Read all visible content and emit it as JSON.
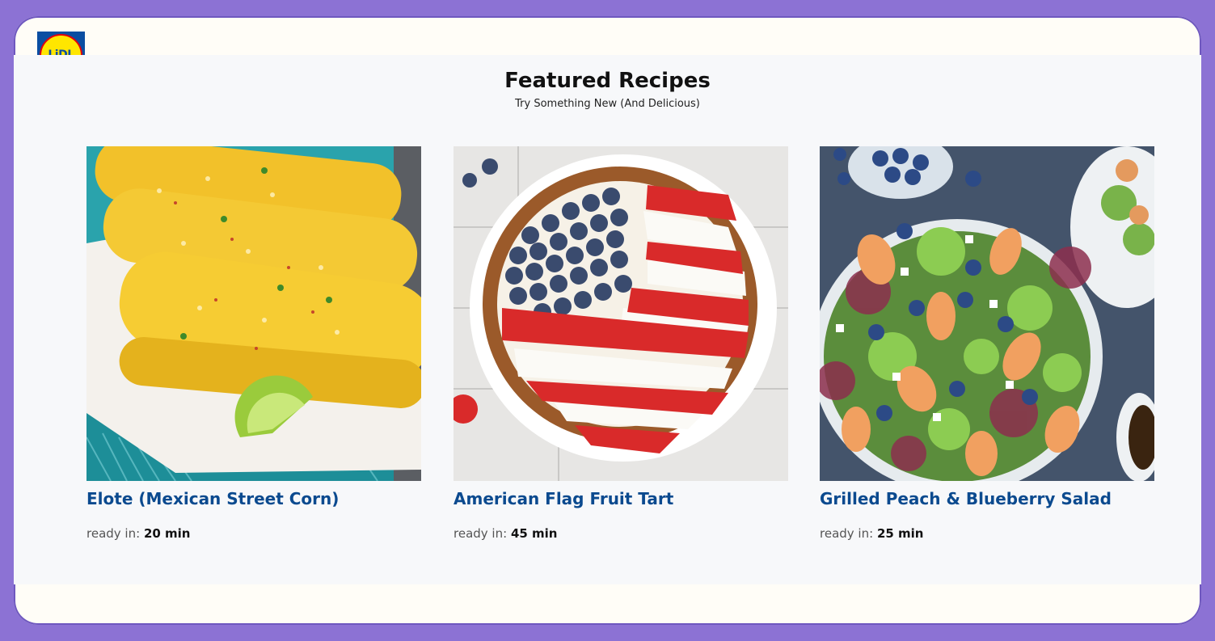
{
  "logo": {
    "text": "LiDL"
  },
  "header": {
    "title": "Featured Recipes",
    "subtitle": "Try Something New (And Delicious)"
  },
  "ready_label": "ready in:",
  "recipes": [
    {
      "title": "Elote (Mexican Street Corn)",
      "time": "20 min",
      "image": "corn-photo"
    },
    {
      "title": "American Flag Fruit Tart",
      "time": "45 min",
      "image": "fruit-tart-photo"
    },
    {
      "title": "Grilled Peach & Blueberry Salad",
      "time": "25 min",
      "image": "salad-photo"
    }
  ],
  "colors": {
    "background": "#8c72d4",
    "card_title": "#0b4a8f",
    "logo_blue": "#0b4ea2",
    "logo_yellow": "#ffe600",
    "logo_red": "#e1000f"
  }
}
